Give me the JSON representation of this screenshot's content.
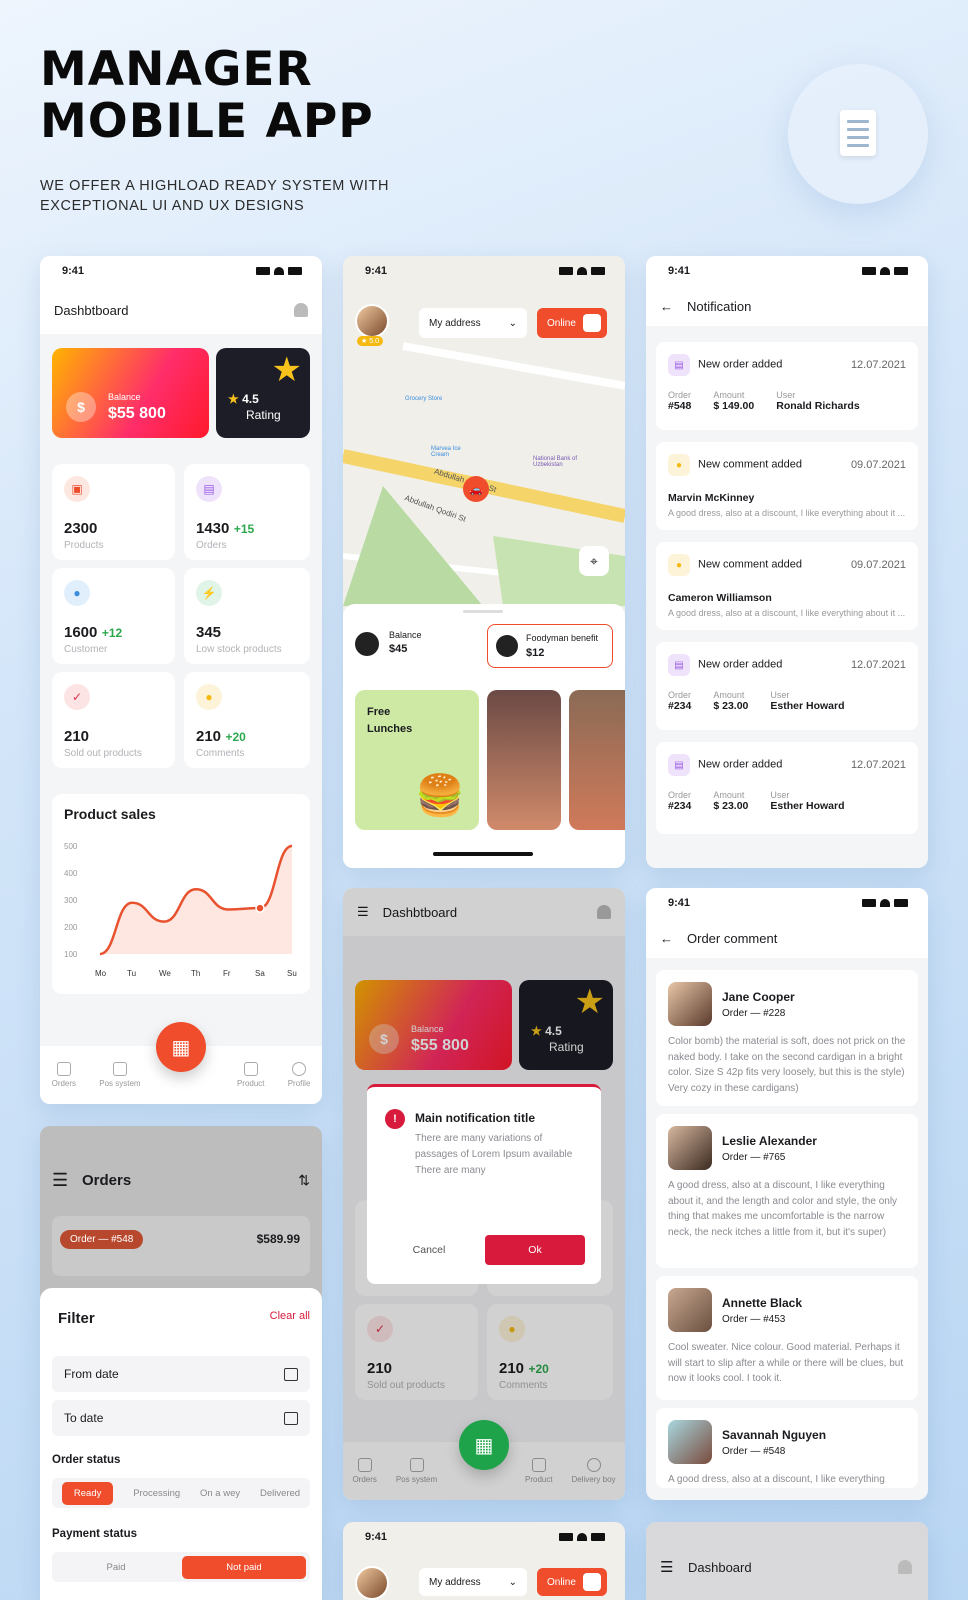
{
  "hero": {
    "title_line1": "MANAGER",
    "title_line2": "MOBILE APP",
    "subtitle_line1": "WE OFFER A HIGHLOAD READY SYSTEM WITH",
    "subtitle_line2": "EXCEPTIONAL UI AND UX DESIGNS"
  },
  "time": "9:41",
  "dashboard": {
    "title": "Dashbtboard",
    "balance_label": "Balance",
    "balance_value": "$55 800",
    "rating_value": "4.5",
    "rating_label": "Rating",
    "stats": [
      {
        "value": "2300",
        "delta": "",
        "label": "Products"
      },
      {
        "value": "1430",
        "delta": "+15",
        "label": "Orders"
      },
      {
        "value": "1600",
        "delta": "+12",
        "label": "Customer"
      },
      {
        "value": "345",
        "delta": "",
        "label": "Low stock products"
      },
      {
        "value": "210",
        "delta": "",
        "label": "Sold out products"
      },
      {
        "value": "210",
        "delta": "+20",
        "label": "Comments"
      }
    ],
    "nav": [
      "Orders",
      "Pos system",
      "Product",
      "Profile"
    ]
  },
  "chart_data": {
    "type": "line",
    "title": "Product sales",
    "categories": [
      "Mo",
      "Tu",
      "We",
      "Th",
      "Fr",
      "Sa",
      "Su"
    ],
    "values": [
      100,
      290,
      220,
      340,
      265,
      270,
      500
    ],
    "yticks": [
      "500",
      "400",
      "300",
      "200",
      "100"
    ],
    "ylim": [
      100,
      500
    ]
  },
  "map": {
    "address": "My address",
    "online": "Online",
    "rating": "5.0",
    "balance_label": "Balance",
    "balance_value": "$45",
    "benefit_label": "Foodyman benefit",
    "benefit_value": "$12",
    "promo": "Free Lunches",
    "street1": "Abdullah Qodiri St",
    "street2": "Abdullah Qodiri St",
    "place1": "Grocery Store",
    "place2": "Marvea Ice Cream",
    "place3": "National Bank of Uzbekistan"
  },
  "notifications": {
    "title": "Notification",
    "items": [
      {
        "type": "New order added",
        "date": "12.07.2021",
        "kind": "order",
        "c1l": "Order",
        "c1": "#548",
        "c2l": "Amount",
        "c2": "$ 149.00",
        "c3l": "User",
        "c3": "Ronald Richards"
      },
      {
        "type": "New comment added",
        "date": "09.07.2021",
        "kind": "comment",
        "name": "Marvin McKinney",
        "text": "A good dress, also at a discount, I like everything about it ..."
      },
      {
        "type": "New comment added",
        "date": "09.07.2021",
        "kind": "comment",
        "name": "Cameron Williamson",
        "text": "A good dress, also at a discount, I like everything about it ..."
      },
      {
        "type": "New order added",
        "date": "12.07.2021",
        "kind": "order",
        "c1l": "Order",
        "c1": "#234",
        "c2l": "Amount",
        "c2": "$ 23.00",
        "c3l": "User",
        "c3": "Esther Howard"
      },
      {
        "type": "New order added",
        "date": "12.07.2021",
        "kind": "order",
        "c1l": "Order",
        "c1": "#234",
        "c2l": "Amount",
        "c2": "$ 23.00",
        "c3l": "User",
        "c3": "Esther Howard"
      }
    ]
  },
  "dialog": {
    "title": "Main notification title",
    "text": "There are many variations of passages of Lorem Ipsum available There are many",
    "cancel": "Cancel",
    "ok": "Ok",
    "nav": [
      "Orders",
      "Pos system",
      "Product",
      "Delivery boy"
    ]
  },
  "comments": {
    "title": "Order comment",
    "items": [
      {
        "name": "Jane Cooper",
        "order": "Order — #228",
        "text": "Color bomb) the material is soft, does not prick on the naked body. I take on the second cardigan in a bright color. Size S 42p fits very loosely, but this is the style) Very cozy in these cardigans)"
      },
      {
        "name": "Leslie Alexander",
        "order": "Order — #765",
        "text": "A good dress, also at a discount, I like everything about it, and the length and color and style, the only thing that makes me uncomfortable is the narrow neck, the neck itches a little from it, but it's super)"
      },
      {
        "name": "Annette Black",
        "order": "Order — #453",
        "text": "Cool sweater. Nice colour. Good material. Perhaps it will start to slip after a while or there will be clues, but now it looks cool. I took it."
      },
      {
        "name": "Savannah Nguyen",
        "order": "Order — #548",
        "text": "A good dress, also at a discount, I like everything"
      }
    ]
  },
  "orders": {
    "title": "Orders",
    "order_pill": "Order — #548",
    "order_amount": "$589.99",
    "filter_title": "Filter",
    "clear": "Clear all",
    "from": "From date",
    "to": "To date",
    "order_status": "Order status",
    "statuses": [
      "Ready",
      "Processing",
      "On a wey",
      "Delivered"
    ],
    "payment_status": "Payment status",
    "payments": [
      "Paid",
      "Not paid"
    ]
  },
  "bottom": {
    "address": "My address",
    "online": "Online",
    "dashboard_title": "Dashboard"
  },
  "colors": {
    "accent": "#ef4d2c",
    "green": "#1fa34a",
    "dark": "#1c1d26",
    "purple": "#9b5de5"
  }
}
